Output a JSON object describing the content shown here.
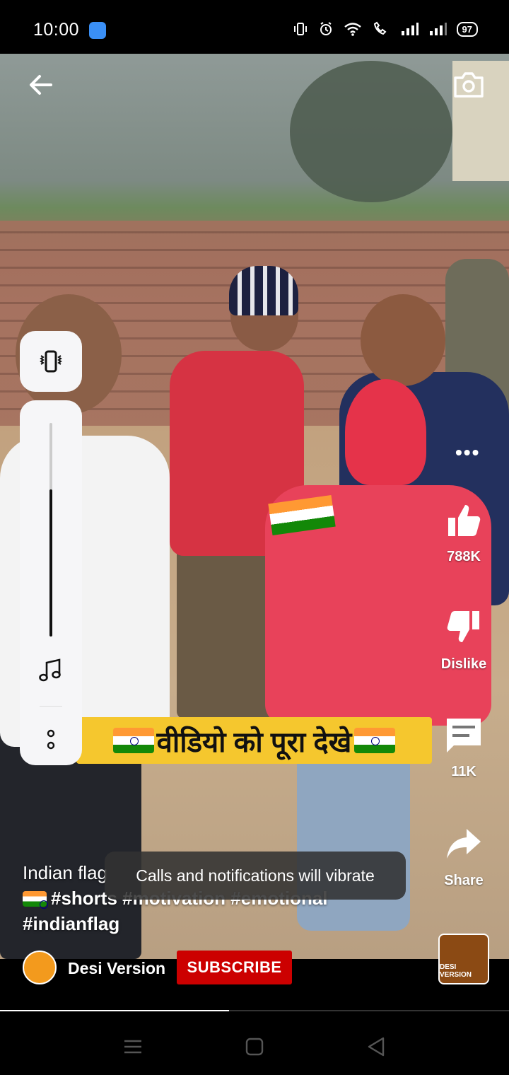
{
  "status_bar": {
    "time": "10:00",
    "battery": "97"
  },
  "video": {
    "caption_banner": "वीडियो को पूरा देखे",
    "title_line": "Indian flag",
    "hashtags_line1": "#shorts #motivation #emotional",
    "hashtags_line2": "#indianflag"
  },
  "actions": {
    "like_count": "788K",
    "dislike_label": "Dislike",
    "comments_count": "11K",
    "share_label": "Share"
  },
  "channel": {
    "name": "Desi Version",
    "subscribe_label": "SUBSCRIBE",
    "thumb_label": "DESI VERSION"
  },
  "toast": {
    "message": "Calls and notifications will vibrate"
  },
  "volume_panel": {
    "level": 0.69,
    "mode": "vibrate"
  },
  "playback": {
    "progress": 0.45
  },
  "icons": {
    "back": "arrow-left-icon",
    "camera": "camera-icon",
    "vibrate": "vibrate-icon",
    "music": "music-note-icon",
    "more": "more-icon",
    "like": "thumbs-up-icon",
    "dislike": "thumbs-down-icon",
    "comment": "comment-icon",
    "share": "share-icon"
  },
  "colors": {
    "subscribe": "#cc0000",
    "banner": "#f5c72e"
  }
}
